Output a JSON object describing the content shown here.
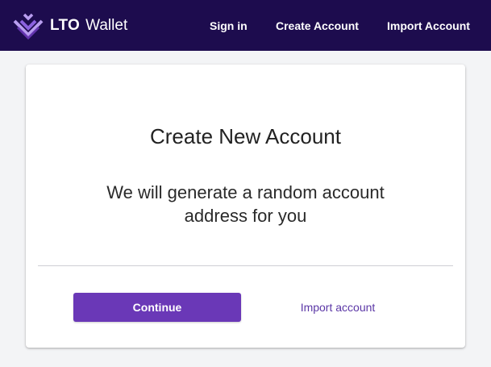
{
  "header": {
    "brand_bold": "LTO",
    "brand_light": "Wallet",
    "logo_icon": "lto-chevron-logo-icon",
    "nav": {
      "sign_in": "Sign in",
      "create_account": "Create Account",
      "import_account": "Import Account"
    }
  },
  "card": {
    "title": "Create New Account",
    "subtitle_line1": "We will generate a random account",
    "subtitle_line2": "address for you",
    "continue_label": "Continue",
    "import_label": "Import account"
  },
  "colors": {
    "header_bg": "#1d0c4e",
    "page_bg": "#f3f4f6",
    "primary": "#6a38b7",
    "link": "#5b37a6",
    "logo_light": "#b99ef0",
    "logo_mid": "#8c62e0",
    "logo_dark": "#6a38b7"
  }
}
